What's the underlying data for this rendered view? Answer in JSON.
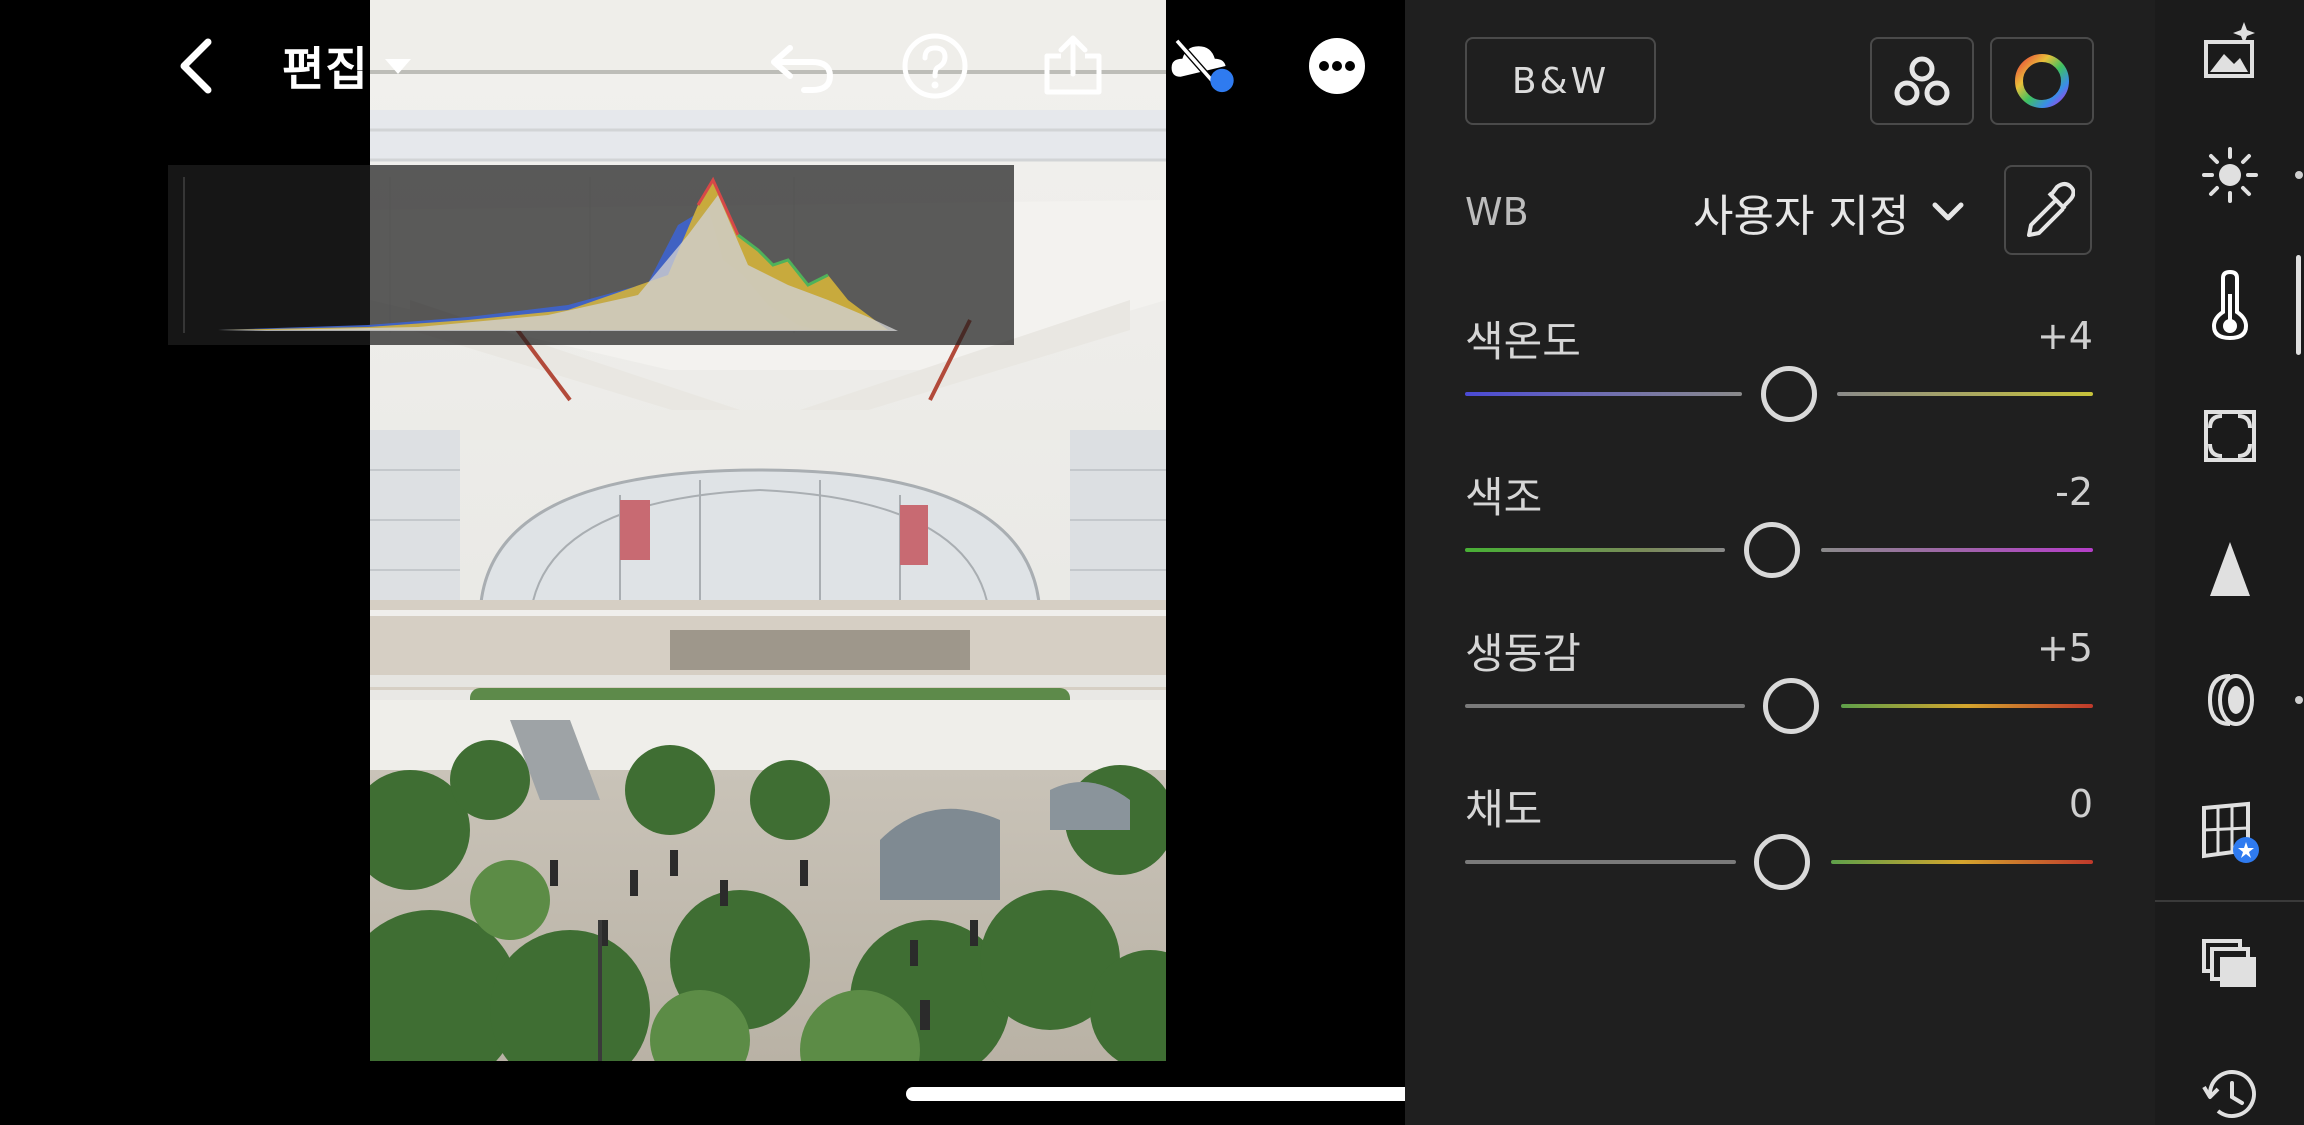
{
  "toolbar": {
    "edit_label": "편집"
  },
  "panel": {
    "bw_label": "B&W",
    "wb": {
      "label": "WB",
      "value": "사용자 지정"
    },
    "sliders": [
      {
        "name": "색온도",
        "value": "+4",
        "level": 0.52
      },
      {
        "name": "색조",
        "value": "-2",
        "level": 0.49
      },
      {
        "name": "생동감",
        "value": "+5",
        "level": 0.525
      },
      {
        "name": "채도",
        "value": "0",
        "level": 0.5
      }
    ]
  },
  "rail": {
    "items": [
      "auto-enhance-icon",
      "light-icon",
      "color-temperature-icon",
      "effects-icon",
      "detail-icon",
      "optics-icon",
      "geometry-icon",
      "versions-icon",
      "history-icon"
    ],
    "active": "color-temperature-icon"
  },
  "colors": {
    "panel_bg": "#1f1f1f",
    "rail_bg": "#1b1b1b",
    "accent_blue": "#2f7bf0",
    "temp_track": [
      "#4a4ad6",
      "#c7c23a"
    ],
    "tint_track": [
      "#48b035",
      "#b53ec9"
    ],
    "vibrance_track": [
      "#8a8a8a",
      "#d4a52d",
      "#c0392b"
    ]
  }
}
